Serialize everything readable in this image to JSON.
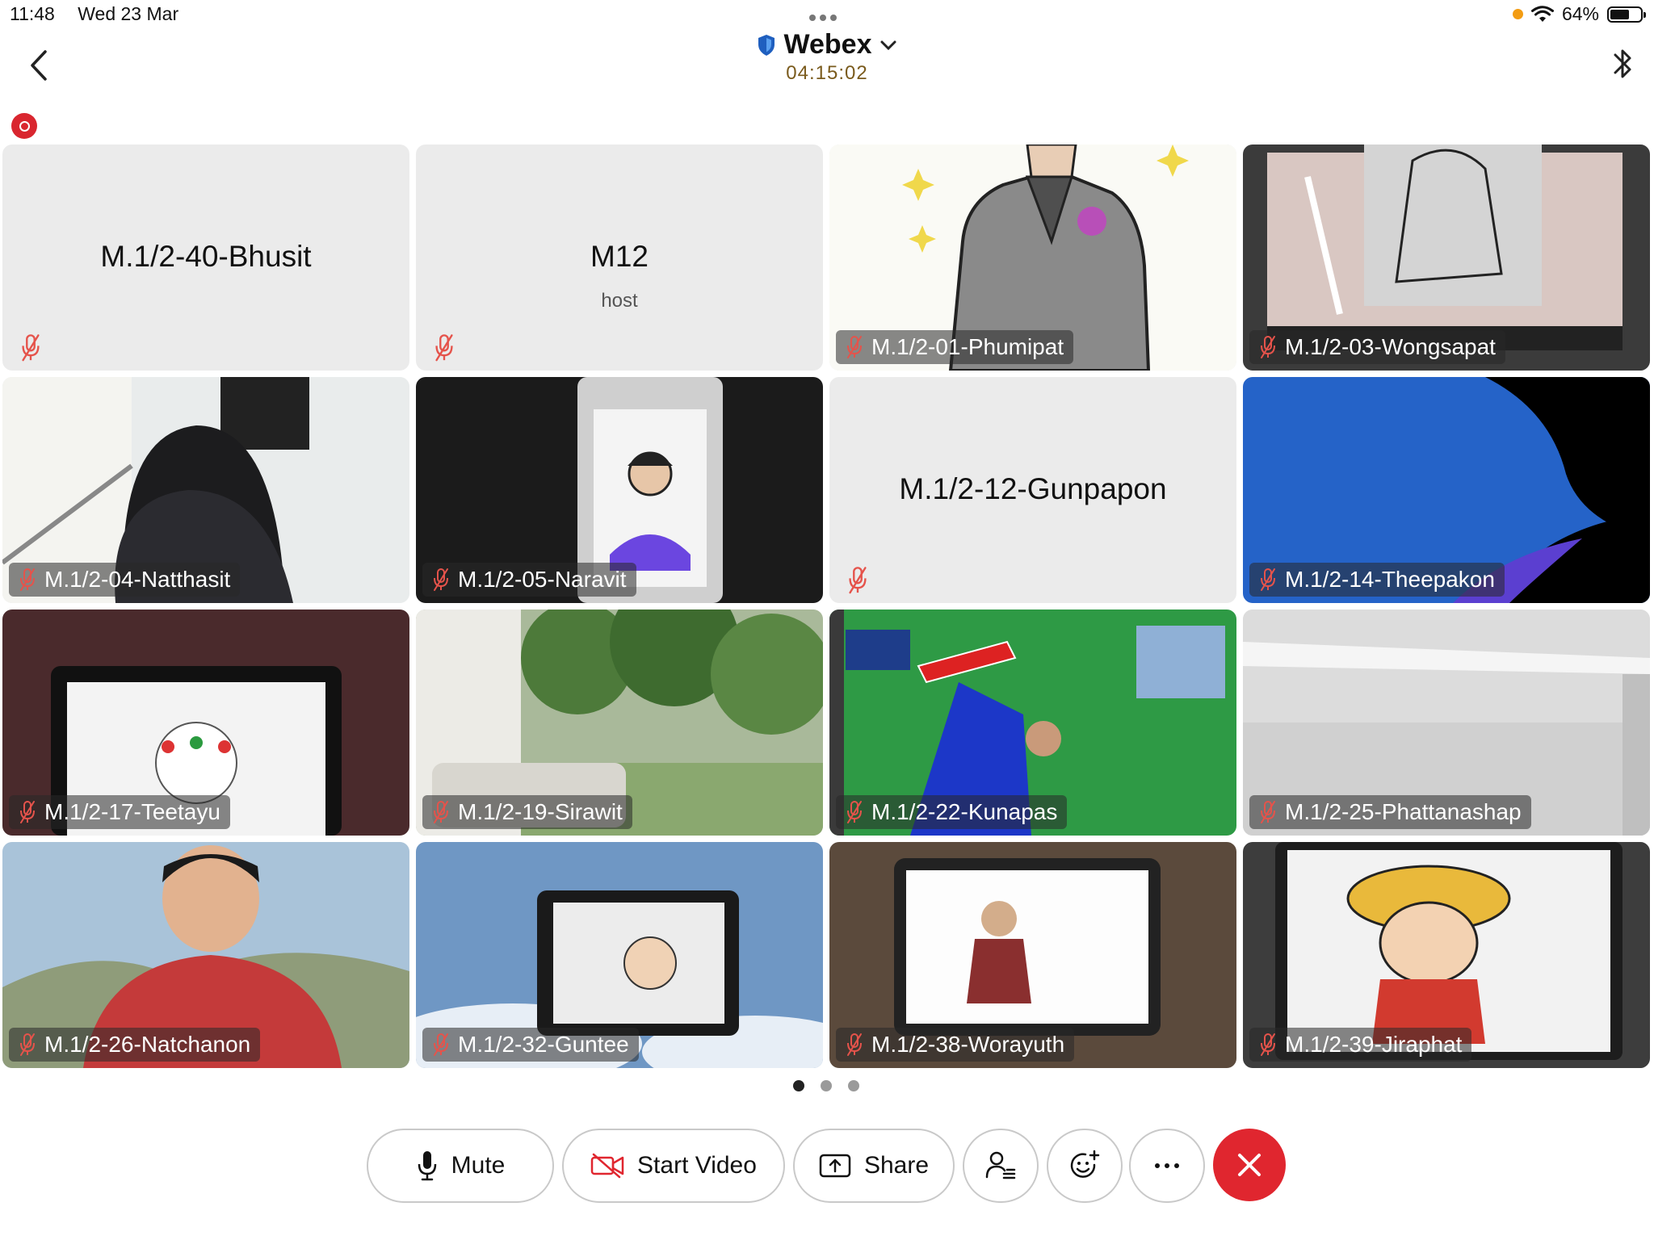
{
  "status_bar": {
    "time": "11:48",
    "date": "Wed 23 Mar",
    "battery": "64%",
    "battery_level": 0.64
  },
  "header": {
    "app_title": "Webex",
    "timer": "04:15:02"
  },
  "participants": [
    {
      "name": "M.1/2-40-Bhusit",
      "role": "",
      "video": false,
      "scene": "none"
    },
    {
      "name": "M12",
      "role": "host",
      "video": false,
      "scene": "none"
    },
    {
      "name": "M.1/2-01-Phumipat",
      "role": "",
      "video": true,
      "scene": "drawing-jacket"
    },
    {
      "name": "M.1/2-03-Wongsapat",
      "role": "",
      "video": true,
      "scene": "tablet-sketch"
    },
    {
      "name": "M.1/2-04-Natthasit",
      "role": "",
      "video": true,
      "scene": "room-chair"
    },
    {
      "name": "M.1/2-05-Naravit",
      "role": "",
      "video": true,
      "scene": "phone-drawing"
    },
    {
      "name": "M.1/2-12-Gunpapon",
      "role": "",
      "video": false,
      "scene": "none"
    },
    {
      "name": "M.1/2-14-Theepakon",
      "role": "",
      "video": true,
      "scene": "blue-abstract"
    },
    {
      "name": "M.1/2-17-Teetayu",
      "role": "",
      "video": true,
      "scene": "tablet-anime"
    },
    {
      "name": "M.1/2-19-Sirawit",
      "role": "",
      "video": true,
      "scene": "forest-room"
    },
    {
      "name": "M.1/2-22-Kunapas",
      "role": "",
      "video": true,
      "scene": "green-flag"
    },
    {
      "name": "M.1/2-25-Phattanashap",
      "role": "",
      "video": true,
      "scene": "white-shelf"
    },
    {
      "name": "M.1/2-26-Natchanon",
      "role": "",
      "video": true,
      "scene": "boy-sky"
    },
    {
      "name": "M.1/2-32-Guntee",
      "role": "",
      "video": true,
      "scene": "sky-tablet"
    },
    {
      "name": "M.1/2-38-Worayuth",
      "role": "",
      "video": true,
      "scene": "tablet-photo"
    },
    {
      "name": "M.1/2-39-Jiraphat",
      "role": "",
      "video": true,
      "scene": "tablet-cartoon"
    }
  ],
  "pagination": {
    "pages": 3,
    "current": 1
  },
  "toolbar": {
    "mute_label": "Mute",
    "start_video_label": "Start Video",
    "share_label": "Share",
    "participants_icon": "participants-list-icon",
    "reactions_icon": "add-reaction-icon",
    "more_icon": "more-options-icon",
    "end_icon": "end-call-icon"
  },
  "colors": {
    "accent_red": "#e0262f",
    "timer_color": "#7a5b1d",
    "muted_icon": "#e5534b",
    "shield_blue": "#1f5fbf"
  }
}
